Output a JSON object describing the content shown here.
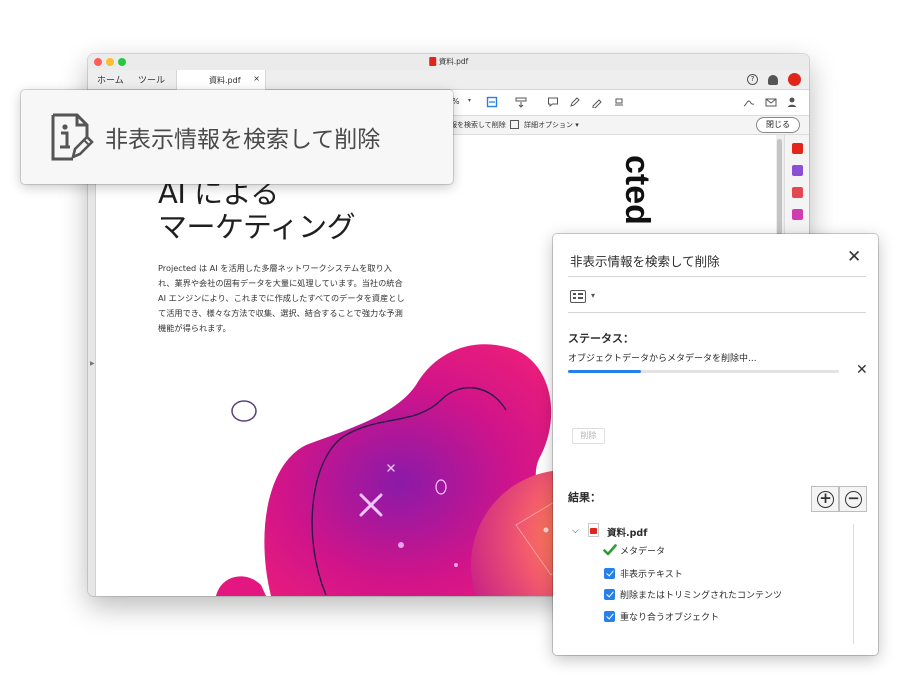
{
  "window": {
    "title": "資料.pdf",
    "tabs": {
      "home": "ホーム",
      "tools": "ツール"
    },
    "doc_tab": {
      "label": "資料.pdf",
      "close": "×"
    },
    "help": "?",
    "toolbar": {
      "zoom_fragment": "%"
    },
    "secondary_toolbar": {
      "find_fragment": "報を検索して削除",
      "advanced_options": "詳細オプション ▾",
      "close_label": "閉じる"
    }
  },
  "document": {
    "heading_line1": "AI による",
    "heading_line2": "マーケティング",
    "body": "Projected は AI を活用した多層ネットワークシステムを取り入れ、業界や会社の固有データを大量に処理しています。当社の統合 AI エンジンにより、これまでに作成したすべてのデータを資産として活用でき、様々な方法で収集、選択、結合することで強力な予測機能が得られます。",
    "vertical_word": "cted"
  },
  "callout": {
    "icon": "info-redact-icon",
    "label": "非表示情報を検索して削除"
  },
  "dialog": {
    "title": "非表示情報を検索して削除",
    "close": "✕",
    "options_caret": "▾",
    "status_label": "ステータス：",
    "status_message": "オブジェクトデータからメタデータを削除中...",
    "progress": 0.27,
    "progress_cancel": "✕",
    "delete_button": "削除",
    "results_label": "結果：",
    "expand": "+",
    "collapse": "−",
    "tree": {
      "caret": "⌵",
      "file": "資料.pdf",
      "items": [
        {
          "label": "メタデータ",
          "check": "green"
        },
        {
          "label": "非表示テキスト",
          "check": "checkbox"
        },
        {
          "label": "削除またはトリミングされたコンテンツ",
          "check": "checkbox"
        },
        {
          "label": "重なり合うオブジェクト",
          "check": "checkbox"
        }
      ]
    }
  },
  "colors": {
    "accent": "#2680eb",
    "adobe_red": "#e1251b",
    "blob_magenta": "#e3177f",
    "blob_orange": "#f7743a"
  }
}
